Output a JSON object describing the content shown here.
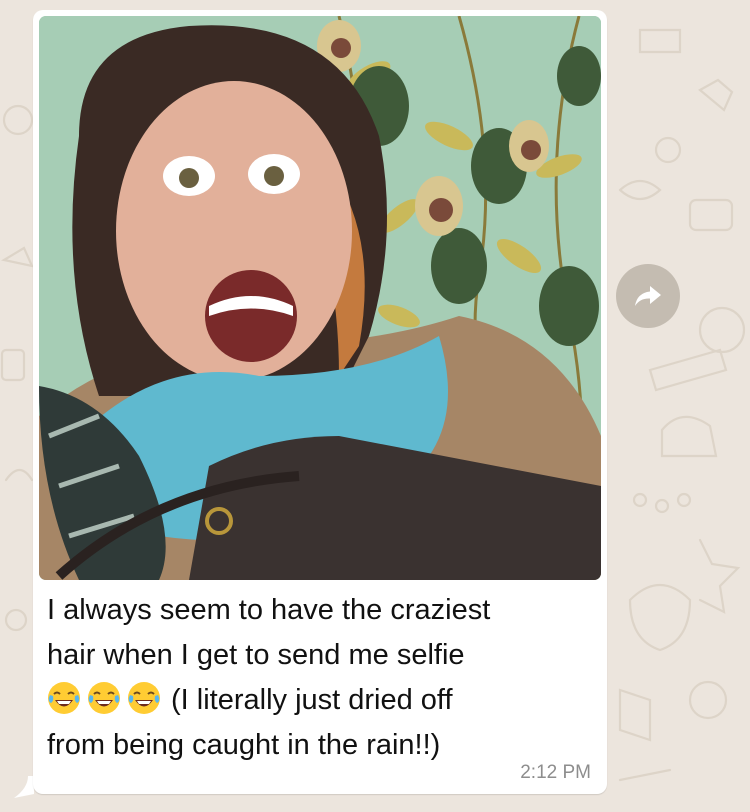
{
  "chat": {
    "message": {
      "caption_lines": [
        "I always seem to have the craziest",
        "hair when I get to send me selfie",
        "(I literally just dried off",
        "from being caught in the rain!!)"
      ],
      "emoji_icons": [
        "face-with-tears-of-joy-icon",
        "face-with-tears-of-joy-icon",
        "face-with-tears-of-joy-icon"
      ],
      "time": "2:12 PM"
    },
    "forward_icon": "forward-arrow-icon"
  },
  "colors": {
    "chat_background": "#ece5dd",
    "bubble": "#ffffff",
    "timestamp": "#8d8d8d",
    "forward_button": "#c4bcb1"
  }
}
